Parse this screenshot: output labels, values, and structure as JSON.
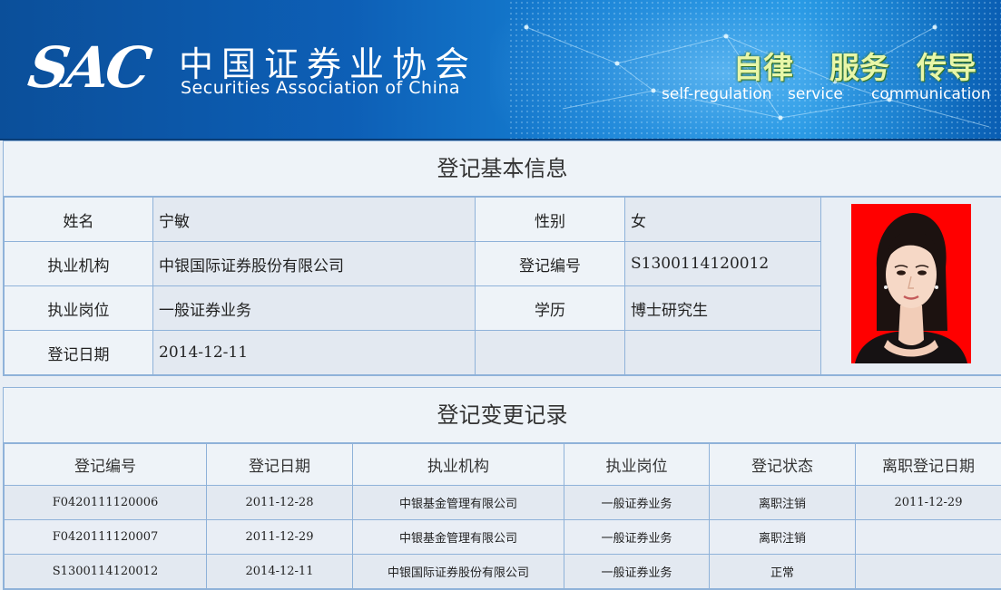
{
  "header": {
    "logo": "SAC",
    "org_name_cn": "中国证券业协会",
    "org_name_en": "Securities Association of China",
    "slogans": [
      {
        "cn": "自律",
        "en": "self-regulation"
      },
      {
        "cn": "服务",
        "en": "service"
      },
      {
        "cn": "传导",
        "en": "communication"
      }
    ]
  },
  "basic_info": {
    "title": "登记基本信息",
    "rows": [
      {
        "label1": "姓名",
        "value1": "宁敏",
        "label2": "性别",
        "value2": "女"
      },
      {
        "label1": "执业机构",
        "value1": "中银国际证券股份有限公司",
        "label2": "登记编号",
        "value2": "S1300114120012"
      },
      {
        "label1": "执业岗位",
        "value1": "一般证券业务",
        "label2": "学历",
        "value2": "博士研究生"
      },
      {
        "label1": "登记日期",
        "value1": "2014-12-11",
        "label2": "",
        "value2": ""
      }
    ],
    "photo_icon": "person-portrait-icon"
  },
  "change_records": {
    "title": "登记变更记录",
    "columns": [
      "登记编号",
      "登记日期",
      "执业机构",
      "执业岗位",
      "登记状态",
      "离职登记日期"
    ],
    "rows": [
      [
        "F0420111120006",
        "2011-12-28",
        "中银基金管理有限公司",
        "一般证券业务",
        "离职注销",
        "2011-12-29"
      ],
      [
        "F0420111120007",
        "2011-12-29",
        "中银基金管理有限公司",
        "一般证券业务",
        "离职注销",
        ""
      ],
      [
        "S1300114120012",
        "2014-12-11",
        "中银国际证券股份有限公司",
        "一般证券业务",
        "正常",
        ""
      ]
    ]
  },
  "colors": {
    "banner": "#0d5fb6",
    "border": "#8fb2d9",
    "photo_bg": "#ff0000"
  }
}
